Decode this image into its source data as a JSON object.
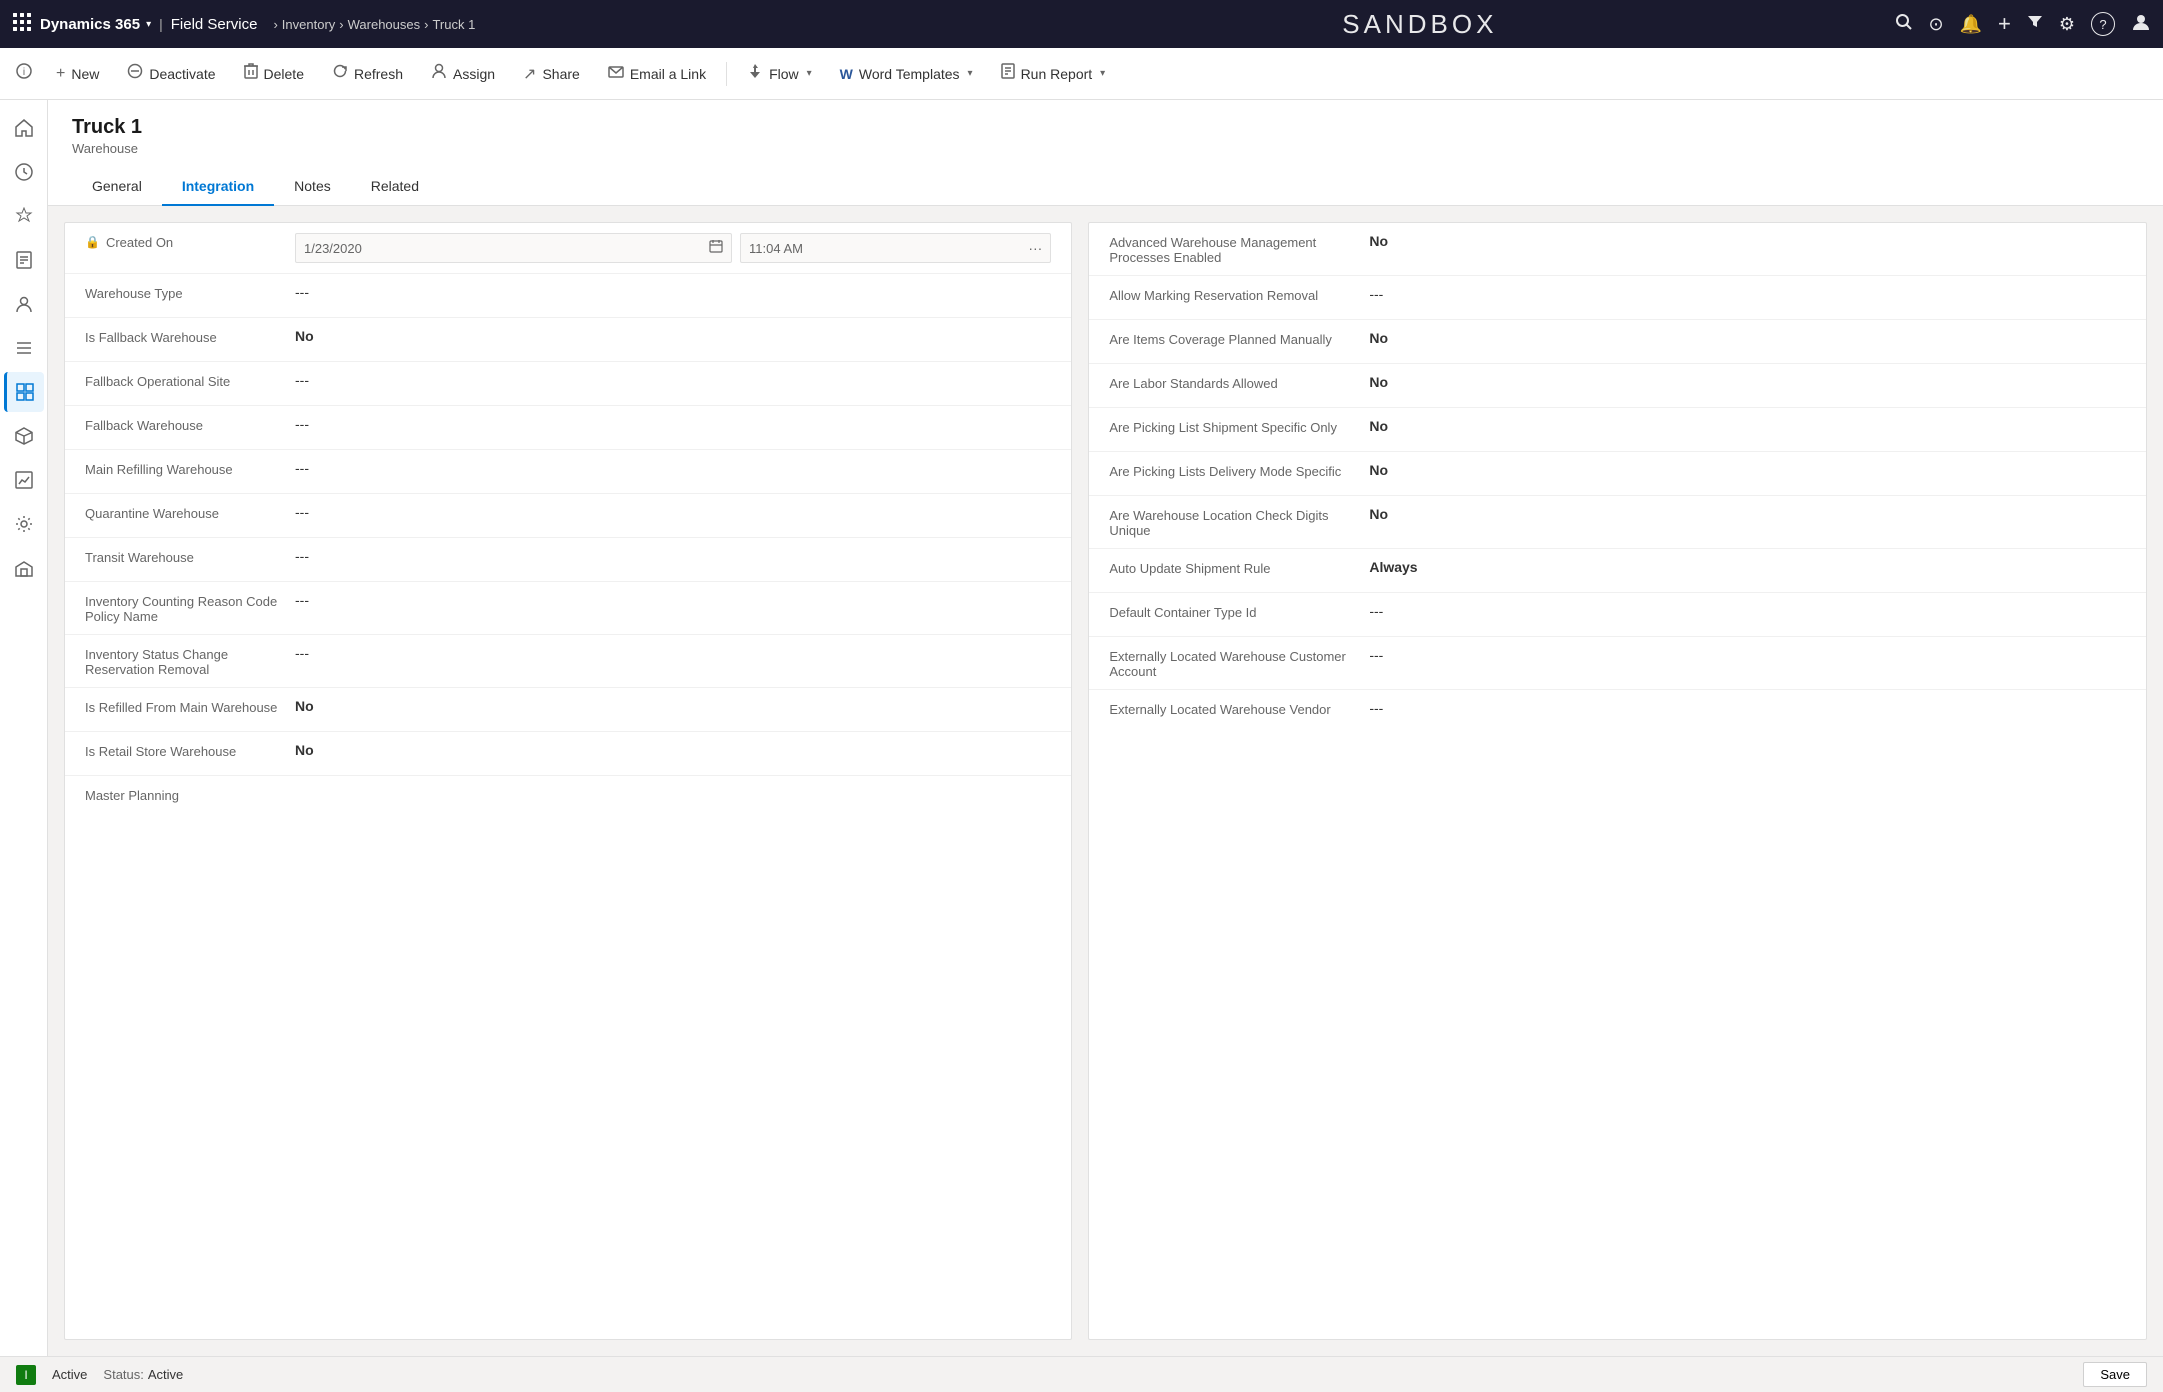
{
  "topNav": {
    "appGridIcon": "⊞",
    "brand": "Dynamics 365",
    "brandArrow": "▾",
    "module": "Field Service",
    "breadcrumb": [
      "Inventory",
      "Warehouses",
      "Truck 1"
    ],
    "sandboxTitle": "SANDBOX",
    "icons": {
      "search": "🔍",
      "target": "⊙",
      "bell": "🔔",
      "plus": "+",
      "filter": "⊟",
      "settings": "⚙",
      "help": "?",
      "user": "👤"
    }
  },
  "commandBar": {
    "leftIcon": "ℹ",
    "buttons": [
      {
        "id": "new",
        "icon": "+",
        "label": "New",
        "hasChevron": false
      },
      {
        "id": "deactivate",
        "icon": "⊗",
        "label": "Deactivate",
        "hasChevron": false
      },
      {
        "id": "delete",
        "icon": "🗑",
        "label": "Delete",
        "hasChevron": false
      },
      {
        "id": "refresh",
        "icon": "↻",
        "label": "Refresh",
        "hasChevron": false
      },
      {
        "id": "assign",
        "icon": "👤",
        "label": "Assign",
        "hasChevron": false
      },
      {
        "id": "share",
        "icon": "↗",
        "label": "Share",
        "hasChevron": false
      },
      {
        "id": "email",
        "icon": "✉",
        "label": "Email a Link",
        "hasChevron": false
      },
      {
        "id": "flow",
        "icon": "⚡",
        "label": "Flow",
        "hasChevron": true
      },
      {
        "id": "word",
        "icon": "W",
        "label": "Word Templates",
        "hasChevron": true
      },
      {
        "id": "report",
        "icon": "📄",
        "label": "Run Report",
        "hasChevron": true
      }
    ]
  },
  "sideNav": {
    "items": [
      {
        "id": "home",
        "icon": "⌂",
        "active": false
      },
      {
        "id": "recent",
        "icon": "🕐",
        "active": false
      },
      {
        "id": "pinned",
        "icon": "📌",
        "active": false
      },
      {
        "id": "notes",
        "icon": "📝",
        "active": false
      },
      {
        "id": "contacts",
        "icon": "👥",
        "active": false
      },
      {
        "id": "calendar",
        "icon": "📅",
        "active": false
      },
      {
        "id": "grid",
        "icon": "▦",
        "active": true
      },
      {
        "id": "cube",
        "icon": "⬡",
        "active": false
      },
      {
        "id": "reports",
        "icon": "📊",
        "active": false
      },
      {
        "id": "settings2",
        "icon": "⚙",
        "active": false
      },
      {
        "id": "warehouse",
        "icon": "🏭",
        "active": false
      }
    ]
  },
  "record": {
    "title": "Truck 1",
    "subtitle": "Warehouse",
    "tabs": [
      {
        "id": "general",
        "label": "General",
        "active": false
      },
      {
        "id": "integration",
        "label": "Integration",
        "active": true
      },
      {
        "id": "notes",
        "label": "Notes",
        "active": false
      },
      {
        "id": "related",
        "label": "Related",
        "active": false
      }
    ]
  },
  "leftSection": {
    "fields": [
      {
        "id": "created-on",
        "label": "Created On",
        "hasLock": true,
        "type": "datetime",
        "dateValue": "1/23/2020",
        "timeValue": "11:04 AM"
      },
      {
        "id": "warehouse-type",
        "label": "Warehouse Type",
        "type": "text",
        "value": "---"
      },
      {
        "id": "is-fallback",
        "label": "Is Fallback Warehouse",
        "type": "text",
        "value": "No",
        "bold": true
      },
      {
        "id": "fallback-op-site",
        "label": "Fallback Operational Site",
        "type": "text",
        "value": "---"
      },
      {
        "id": "fallback-warehouse",
        "label": "Fallback Warehouse",
        "type": "text",
        "value": "---"
      },
      {
        "id": "main-refilling",
        "label": "Main Refilling Warehouse",
        "type": "text",
        "value": "---"
      },
      {
        "id": "quarantine-warehouse",
        "label": "Quarantine Warehouse",
        "type": "text",
        "value": "---"
      },
      {
        "id": "transit-warehouse",
        "label": "Transit Warehouse",
        "type": "text",
        "value": "---"
      },
      {
        "id": "inventory-counting",
        "label": "Inventory Counting Reason Code Policy Name",
        "type": "text",
        "value": "---"
      },
      {
        "id": "inventory-status",
        "label": "Inventory Status Change Reservation Removal",
        "type": "text",
        "value": "---"
      },
      {
        "id": "is-refilled",
        "label": "Is Refilled From Main Warehouse",
        "type": "text",
        "value": "No",
        "bold": true
      },
      {
        "id": "is-retail",
        "label": "Is Retail Store Warehouse",
        "type": "text",
        "value": "No",
        "bold": true
      },
      {
        "id": "master-planning",
        "label": "Master Planning",
        "type": "text",
        "value": ""
      }
    ]
  },
  "rightSection": {
    "fields": [
      {
        "id": "advanced-wm",
        "label": "Advanced Warehouse Management Processes Enabled",
        "value": "No",
        "bold": true
      },
      {
        "id": "allow-marking",
        "label": "Allow Marking Reservation Removal",
        "value": "---",
        "bold": false
      },
      {
        "id": "items-coverage",
        "label": "Are Items Coverage Planned Manually",
        "value": "No",
        "bold": true
      },
      {
        "id": "labor-standards",
        "label": "Are Labor Standards Allowed",
        "value": "No",
        "bold": true
      },
      {
        "id": "picking-list-shipment",
        "label": "Are Picking List Shipment Specific Only",
        "value": "No",
        "bold": true
      },
      {
        "id": "picking-lists-delivery",
        "label": "Are Picking Lists Delivery Mode Specific",
        "value": "No",
        "bold": true
      },
      {
        "id": "warehouse-location",
        "label": "Are Warehouse Location Check Digits Unique",
        "value": "No",
        "bold": true
      },
      {
        "id": "auto-update",
        "label": "Auto Update Shipment Rule",
        "value": "Always",
        "bold": true
      },
      {
        "id": "default-container",
        "label": "Default Container Type Id",
        "value": "---",
        "bold": false
      },
      {
        "id": "externally-customer",
        "label": "Externally Located Warehouse Customer Account",
        "value": "---",
        "bold": false
      },
      {
        "id": "externally-vendor",
        "label": "Externally Located Warehouse Vendor",
        "value": "---",
        "bold": false
      }
    ]
  },
  "statusBar": {
    "indicator": "I",
    "activeLabel": "Active",
    "statusLabel": "Status:",
    "statusValue": "Active",
    "saveLabel": "Save"
  }
}
